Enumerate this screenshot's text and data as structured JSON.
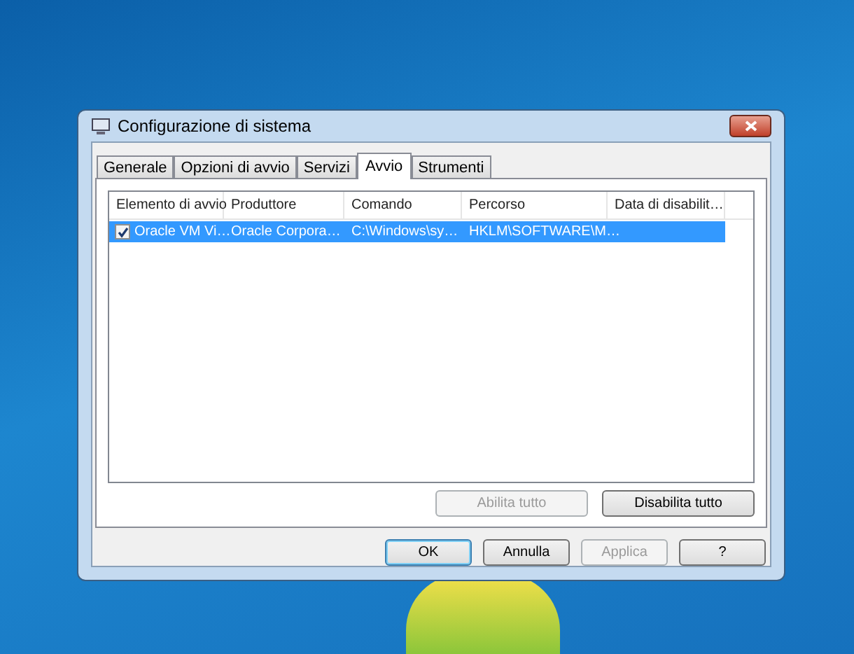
{
  "window": {
    "title": "Configurazione di sistema"
  },
  "tabs": [
    {
      "label": "Generale",
      "selected": false
    },
    {
      "label": "Opzioni di avvio",
      "selected": false
    },
    {
      "label": "Servizi",
      "selected": false
    },
    {
      "label": "Avvio",
      "selected": true
    },
    {
      "label": "Strumenti",
      "selected": false
    }
  ],
  "table": {
    "columns": [
      "Elemento di avvio",
      "Produttore",
      "Comando",
      "Percorso",
      "Data di disabilit…"
    ],
    "rows": [
      {
        "checked": true,
        "selected": true,
        "cells": [
          "Oracle VM Vi…",
          "Oracle Corpora…",
          "C:\\Windows\\sy…",
          "HKLM\\SOFTWARE\\M…",
          ""
        ]
      }
    ]
  },
  "list_buttons": [
    {
      "label": "Abilita tutto",
      "disabled": true
    },
    {
      "label": "Disabilita tutto",
      "disabled": false
    }
  ],
  "buttons": [
    {
      "label": "OK",
      "disabled": false,
      "default": true
    },
    {
      "label": "Annulla",
      "disabled": false,
      "default": false
    },
    {
      "label": "Applica",
      "disabled": true,
      "default": false
    },
    {
      "label": "?",
      "disabled": false,
      "default": false
    }
  ]
}
